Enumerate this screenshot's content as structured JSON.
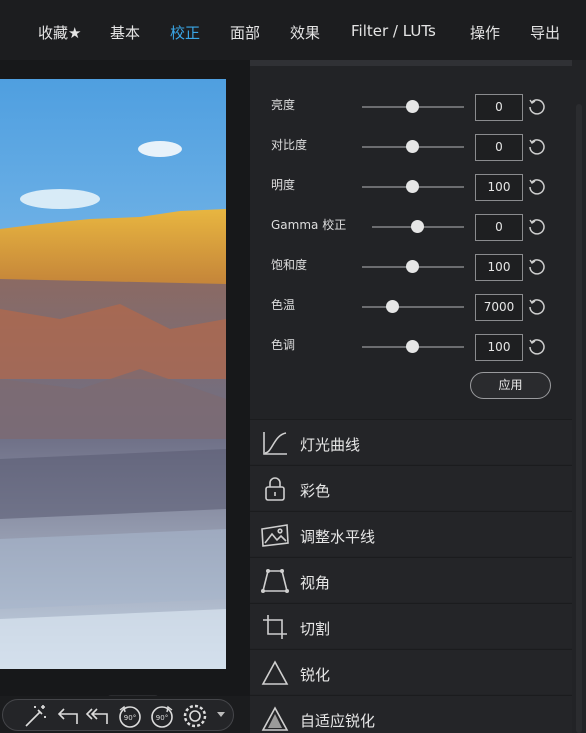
{
  "menu": {
    "items": [
      {
        "label": "收藏★",
        "active": false
      },
      {
        "label": "基本",
        "active": false
      },
      {
        "label": "校正",
        "active": true
      },
      {
        "label": "面部",
        "active": false
      },
      {
        "label": "效果",
        "active": false
      },
      {
        "label": "Filter / LUTs",
        "active": false
      },
      {
        "label": "操作",
        "active": false
      },
      {
        "label": "导出",
        "active": false
      }
    ]
  },
  "adjustments": [
    {
      "label": "亮度",
      "value": "0",
      "level": 0.5
    },
    {
      "label": "对比度",
      "value": "0",
      "level": 0.5
    },
    {
      "label": "明度",
      "value": "100",
      "level": 0.5
    },
    {
      "label": "Gamma 校正",
      "value": "0",
      "level": 0.5
    },
    {
      "label": "饱和度",
      "value": "100",
      "level": 0.5
    },
    {
      "label": "色温",
      "value": "7000",
      "level": 0.3
    },
    {
      "label": "色调",
      "value": "100",
      "level": 0.5
    }
  ],
  "apply_label": "应用",
  "sections": [
    {
      "label": "灯光曲线",
      "icon": "curve-icon"
    },
    {
      "label": "彩色",
      "icon": "lock-icon"
    },
    {
      "label": "调整水平线",
      "icon": "landscape-icon"
    },
    {
      "label": "视角",
      "icon": "perspective-icon"
    },
    {
      "label": "切割",
      "icon": "crop-icon"
    },
    {
      "label": "锐化",
      "icon": "triangle-icon"
    },
    {
      "label": "自适应锐化",
      "icon": "triangle-filled-icon"
    }
  ],
  "toolbar": {
    "icons": [
      "magic-wand-icon",
      "undo-icon",
      "undo-all-icon",
      "rotate-left-icon",
      "rotate-right-icon",
      "settings-icon"
    ],
    "rotate_label": "90°"
  },
  "colors": {
    "accent": "#3aa6e6",
    "panel": "#222326",
    "background": "#1b1c1e"
  }
}
